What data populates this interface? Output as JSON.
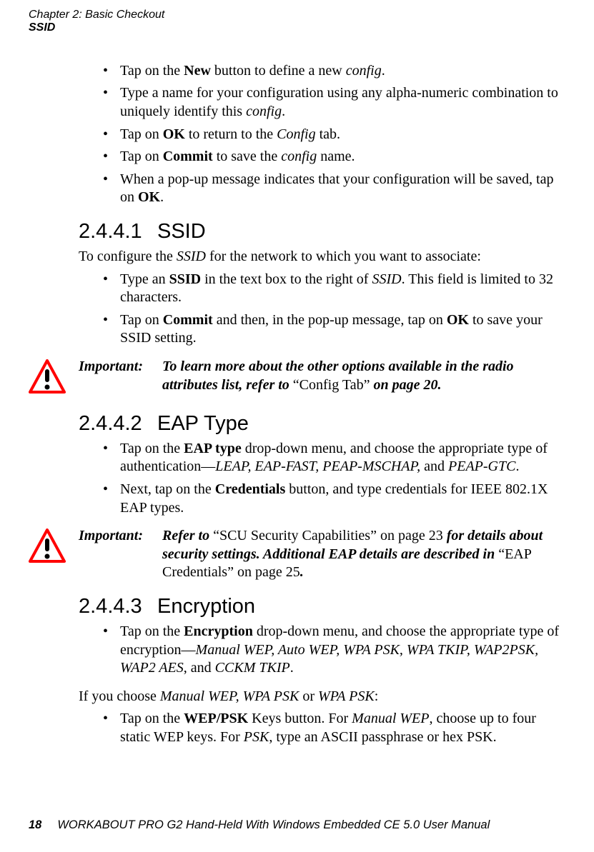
{
  "header": {
    "chapter_line": "Chapter  2:  Basic Checkout",
    "section_line": "SSID"
  },
  "intro_bullets": {
    "b1_pre": "Tap on the ",
    "b1_bold": "New",
    "b1_mid": " button to define a new ",
    "b1_ital": "config",
    "b1_post": ".",
    "b2_pre": "Type a name for your configuration using any alpha-numeric combination to uniquely identify this ",
    "b2_ital": "config",
    "b2_post": ".",
    "b3_pre": "Tap on ",
    "b3_bold": "OK",
    "b3_mid": " to return to the ",
    "b3_ital": "Config",
    "b3_post": " tab.",
    "b4_pre": "Tap on ",
    "b4_bold": "Commit",
    "b4_mid": " to save the ",
    "b4_ital": "config",
    "b4_post": " name.",
    "b5_pre": "When a pop-up message indicates that your configuration will be saved, tap on ",
    "b5_bold": "OK",
    "b5_post": "."
  },
  "sec_ssid": {
    "num": "2.4.4.1",
    "title": "SSID",
    "intro_pre": "To configure the ",
    "intro_ital": "SSID",
    "intro_post": " for the network to which you want to associate:",
    "b1_pre": "Type an ",
    "b1_bold": "SSID",
    "b1_mid": " in the text box to the right of ",
    "b1_ital": "SSID",
    "b1_post": ". This field is limited to 32 characters.",
    "b2_pre": "Tap on ",
    "b2_bold": "Commit",
    "b2_mid": " and then, in the pop-up message, tap on ",
    "b2_bold2": "OK",
    "b2_post": " to save your SSID setting."
  },
  "important1": {
    "label": "Important:",
    "pre": "To learn more about the other options available in the radio attributes list, refer to ",
    "quote": "“Config Tab”",
    "post": " on page 20."
  },
  "sec_eap": {
    "num": "2.4.4.2",
    "title": "EAP Type",
    "b1_pre": "Tap on the ",
    "b1_bold": "EAP type",
    "b1_mid": " drop-down menu, and choose the appropriate type of authentication—",
    "b1_ital": "LEAP, EAP-FAST, PEAP-MSCHAP,",
    "b1_mid2": " and ",
    "b1_ital2": "PEAP-GTC",
    "b1_post": ".",
    "b2_pre": "Next, tap on the ",
    "b2_bold": "Credentials",
    "b2_post": " button, and type credentials for IEEE 802.1X EAP types."
  },
  "important2": {
    "label": "Important:",
    "pre": "Refer to ",
    "quote1": "“SCU Security Capabilities” on page 23",
    "mid": " for details about security settings. Additional EAP details are described in ",
    "quote2": "“EAP Credentials” on page 25",
    "post": "."
  },
  "sec_enc": {
    "num": "2.4.4.3",
    "title": "Encryption",
    "b1_pre": "Tap on the ",
    "b1_bold": "Encryption",
    "b1_mid": " drop-down menu, and choose the appropriate type of encryption—",
    "b1_ital": "Manual WEP, Auto WEP, WPA PSK, WPA TKIP, WAP2PSK, WAP2 AES",
    "b1_mid2": ", and ",
    "b1_ital2": "CCKM TKIP",
    "b1_post": ".",
    "after_pre": "If you choose ",
    "after_ital": "Manual WEP, WPA PSK",
    "after_mid": " or ",
    "after_ital2": "WPA PSK",
    "after_post": ":",
    "b2_pre": "Tap on the ",
    "b2_bold": "WEP/PSK",
    "b2_mid": " Keys button. For ",
    "b2_ital": "Manual WEP",
    "b2_mid2": ", choose up to four static WEP keys. For ",
    "b2_ital2": "PSK",
    "b2_post": ", type an ASCII passphrase or hex PSK."
  },
  "footer": {
    "page": "18",
    "title": "WORKABOUT PRO G2 Hand-Held With Windows Embedded CE 5.0 User Manual"
  }
}
